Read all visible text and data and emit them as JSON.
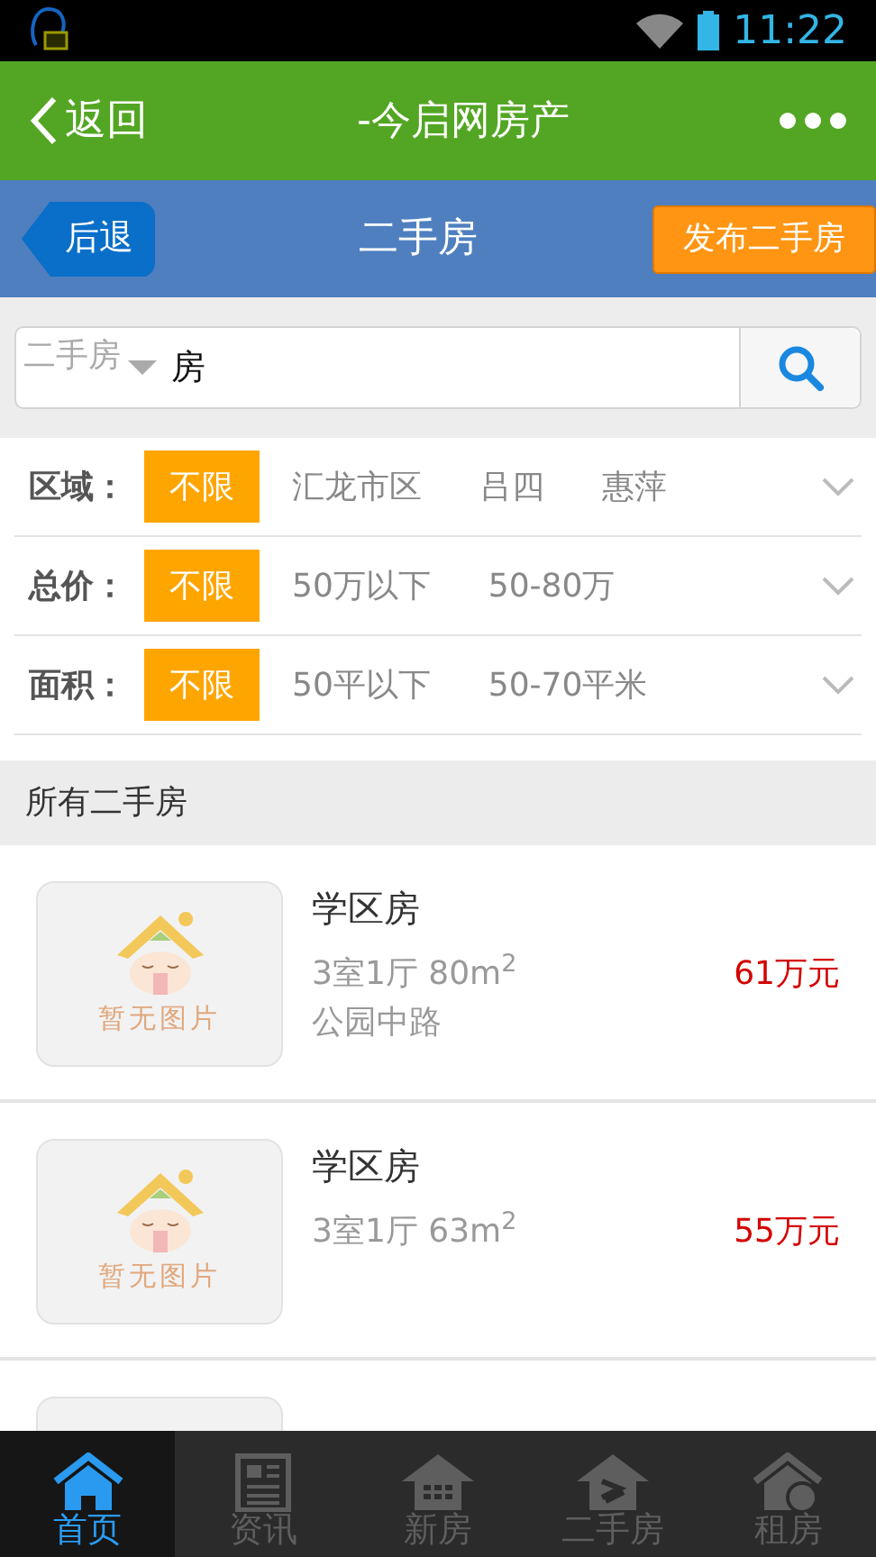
{
  "status_bar": {
    "time": "11:22"
  },
  "app_bar": {
    "back": "返回",
    "title": "-今启网房产"
  },
  "page_bar": {
    "back": "后退",
    "title": "二手房",
    "action": "发布二手房"
  },
  "search": {
    "category": "二手房",
    "value": "房"
  },
  "filters": [
    {
      "label": "区域：",
      "options": [
        {
          "text": "不限",
          "selected": true
        },
        {
          "text": "汇龙市区",
          "selected": false
        },
        {
          "text": "吕四",
          "selected": false
        },
        {
          "text": "惠萍",
          "selected": false
        }
      ]
    },
    {
      "label": "总价：",
      "options": [
        {
          "text": "不限",
          "selected": true
        },
        {
          "text": "50万以下",
          "selected": false
        },
        {
          "text": "50-80万",
          "selected": false
        }
      ]
    },
    {
      "label": "面积：",
      "options": [
        {
          "text": "不限",
          "selected": true
        },
        {
          "text": "50平以下",
          "selected": false
        },
        {
          "text": "50-70平米",
          "selected": false
        }
      ]
    }
  ],
  "section_title": "所有二手房",
  "listings": [
    {
      "kind": "listing",
      "placeholder_text": "暂无图片",
      "title": "学区房",
      "specs": "3室1厅 80m$^{2}$",
      "price": "61万元",
      "address": "公园中路"
    },
    {
      "kind": "listing",
      "placeholder_text": "暂无图片",
      "title": "学区房",
      "specs": "3室1厅 63m$^{2}$",
      "price": "55万元"
    },
    {
      "kind": "partial"
    }
  ],
  "tabs": [
    {
      "label": "首页",
      "kind": "home",
      "selected": true
    },
    {
      "label": "资讯",
      "kind": "news",
      "selected": false
    },
    {
      "label": "新房",
      "kind": "new",
      "selected": false
    },
    {
      "label": "二手房",
      "kind": "resale",
      "selected": false
    },
    {
      "label": "租房",
      "kind": "rent",
      "selected": false
    }
  ]
}
